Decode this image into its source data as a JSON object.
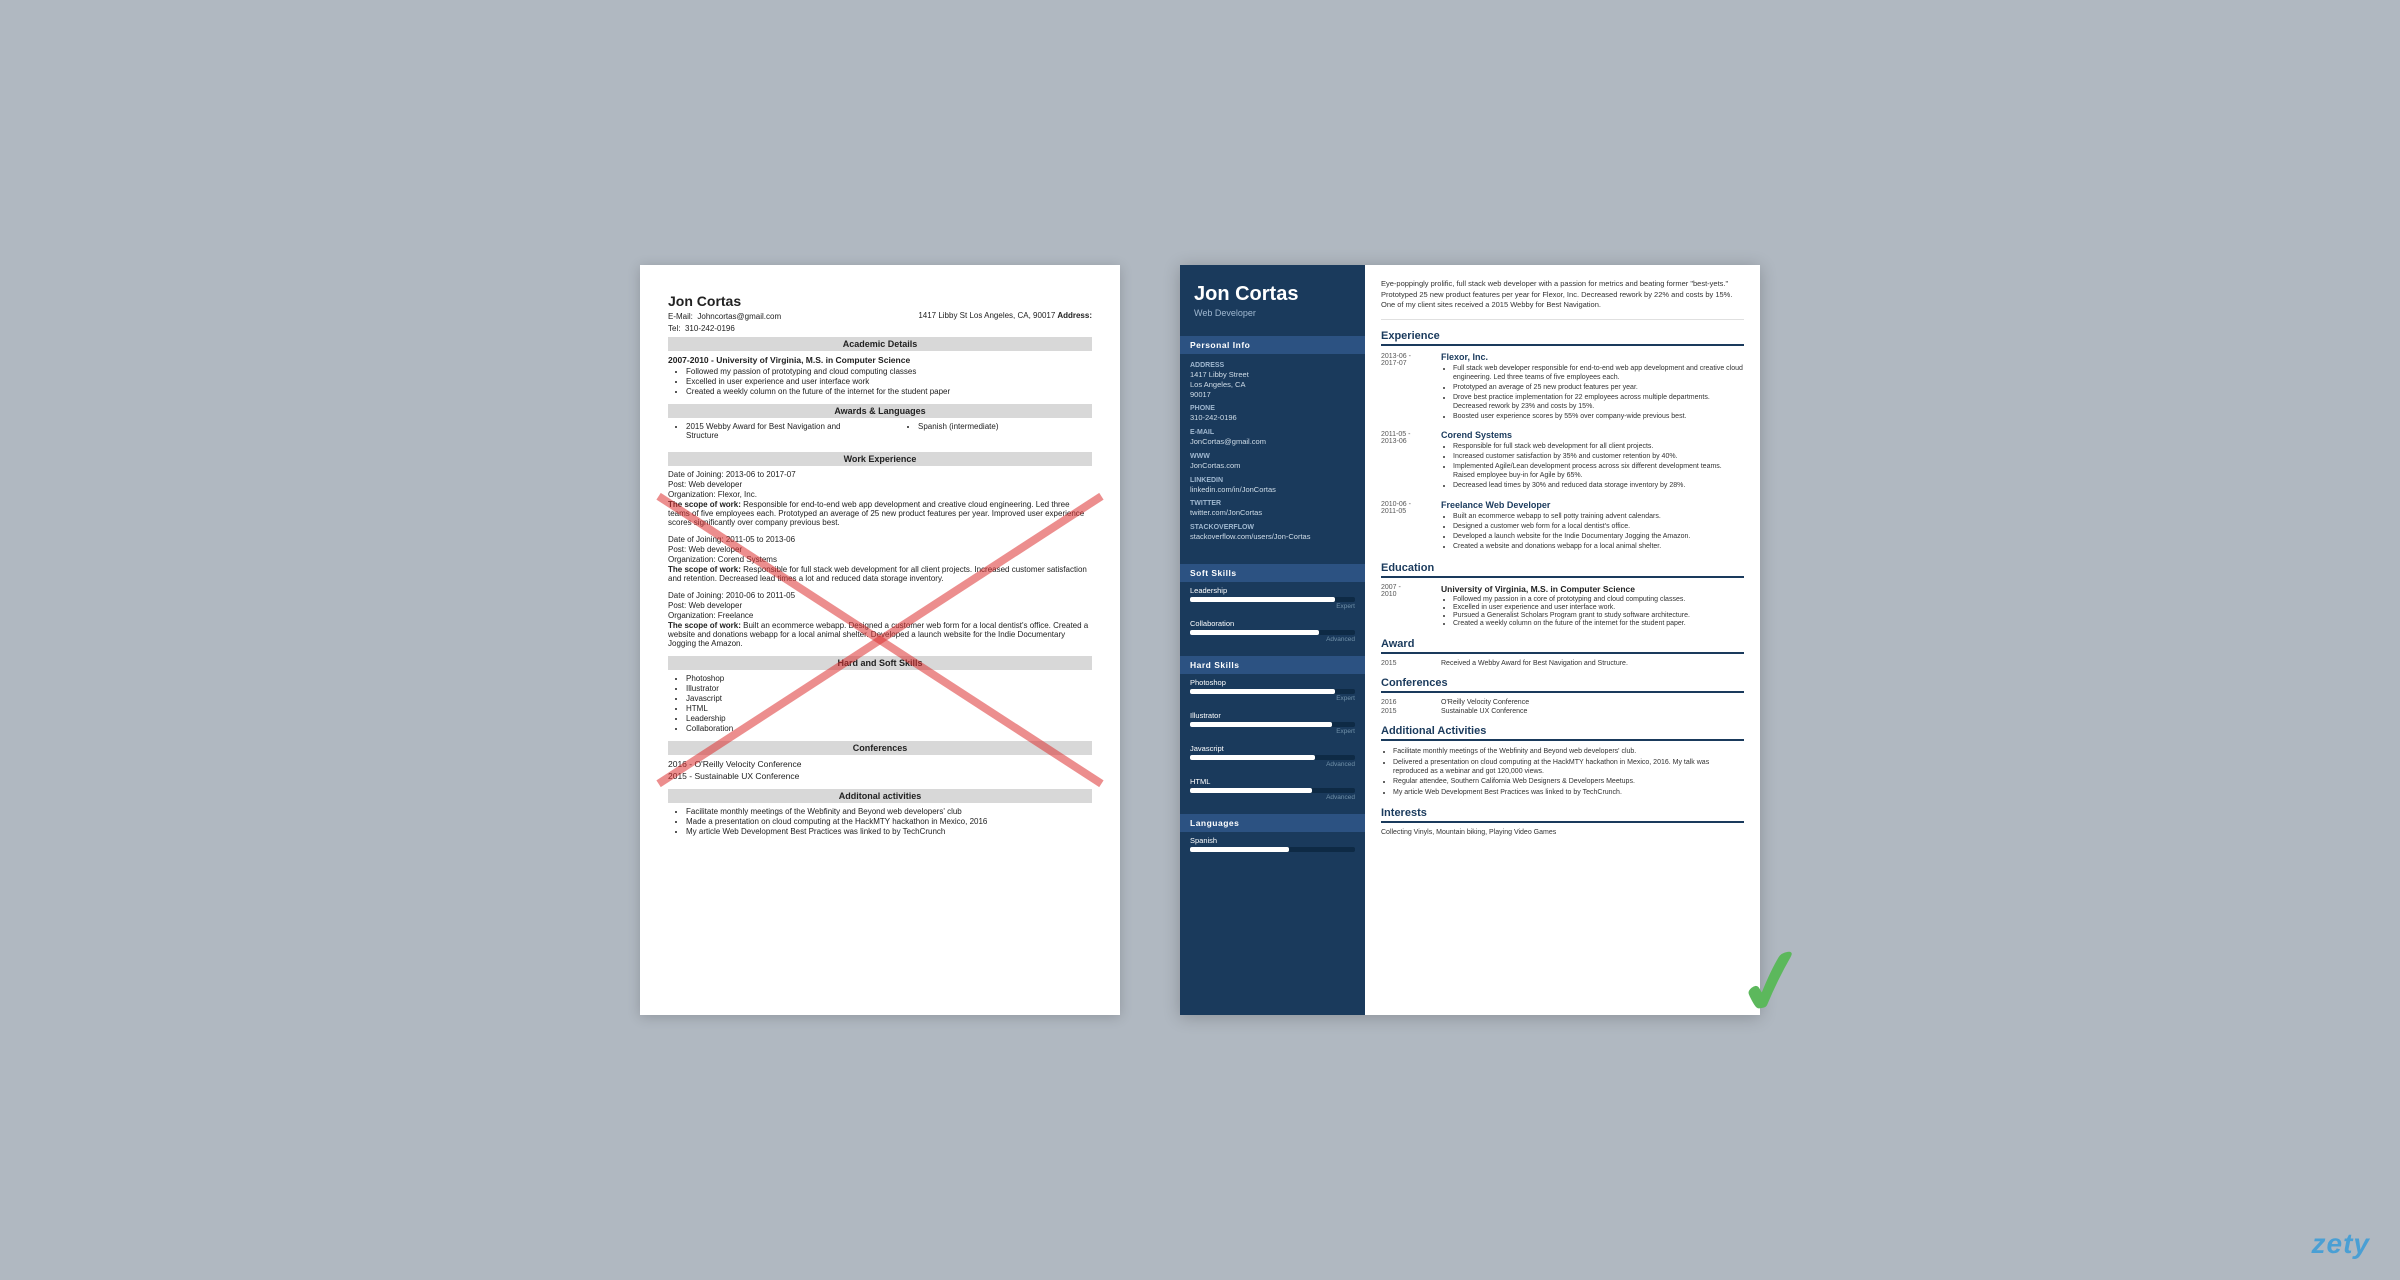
{
  "left_resume": {
    "name": "Jon Cortas",
    "email_label": "E-Mail:",
    "email": "Johncortas@gmail.com",
    "address_label": "Address:",
    "address": "1417 Libby St Los Angeles, CA, 90017",
    "tel_label": "Tel:",
    "tel": "310-242-0196",
    "academic": {
      "header": "Academic Details",
      "entry": "2007-2010 - University of Virginia, M.S. in Computer Science",
      "bullets": [
        "Followed my passion of prototyping and cloud computing classes",
        "Excelled in user experience and user interface work",
        "Created a weekly column on the future of the internet for the student paper"
      ]
    },
    "awards": {
      "header": "Awards & Languages",
      "award": "2015 Webby Award for Best Navigation and Structure",
      "language": "Spanish (intermediate)"
    },
    "work": {
      "header": "Work Experience",
      "jobs": [
        {
          "date": "Date of Joining: 2013-06 to 2017-07",
          "post": "Post: Web developer",
          "org": "Organization: Flexor, Inc.",
          "scope_label": "The scope of work:",
          "scope": "Responsible for end-to-end web app development and creative cloud engineering. Led three teams of five employees each. Prototyped an average of 25 new product features per year. Improved user experience scores significantly over company previous best."
        },
        {
          "date": "Date of Joining: 2011-05 to 2013-06",
          "post": "Post: Web developer",
          "org": "Organization: Corend Systems",
          "scope_label": "The scope of work:",
          "scope": "Responsible for full stack web development for all client projects. Increased customer satisfaction and retention. Decreased lead times a lot and reduced data storage inventory."
        },
        {
          "date": "Date of Joining: 2010-06 to 2011-05",
          "post": "Post: Web developer",
          "org": "Organization: Freelance",
          "scope_label": "The scope of work:",
          "scope": "Built an ecommerce webapp. Designed a customer web form for a local dentist's office. Created a website and donations webapp for a local animal shelter. Developed a launch website for the Indie Documentary Jogging the Amazon."
        }
      ]
    },
    "skills": {
      "header": "Hard and Soft Skills",
      "items": [
        "Photoshop",
        "Illustrator",
        "Javascript",
        "HTML",
        "Leadership",
        "Collaboration"
      ]
    },
    "conferences": {
      "header": "Conferences",
      "items": [
        "2016 - O'Reilly Velocity Conference",
        "2015 - Sustainable UX Conference"
      ]
    },
    "activities": {
      "header": "Additonal activities",
      "items": [
        "Facilitate monthly meetings of the Webfinity and Beyond web developers' club",
        "Made a presentation on cloud computing at the HackMTY hackathon in Mexico, 2016",
        "My article Web Development Best Practices was linked to by TechCrunch"
      ]
    }
  },
  "right_resume": {
    "name": "Jon Cortas",
    "title": "Web Developer",
    "summary": "Eye-poppingly prolific, full stack web developer with a passion for metrics and beating former \"best-yets.\" Prototyped 25 new product features per year for Flexor, Inc. Decreased rework by 22% and costs by 15%. One of my client sites received a 2015 Webby for Best Navigation.",
    "sidebar": {
      "personal_info_label": "Personal Info",
      "address_label": "Address",
      "address": "1417 Libby Street\nLos Angeles, CA\n90017",
      "phone_label": "Phone",
      "phone": "310-242-0196",
      "email_label": "E-mail",
      "email": "JonCortas@gmail.com",
      "www_label": "WWW",
      "www": "JonCortas.com",
      "linkedin_label": "LinkedIn",
      "linkedin": "linkedin.com/in/JonCortas",
      "twitter_label": "Twitter",
      "twitter": "twitter.com/JonCortas",
      "stackoverflow_label": "StackOverflow",
      "stackoverflow": "stackoverflow.com/users/Jon-Cortas",
      "soft_skills_label": "Soft Skills",
      "soft_skills": [
        {
          "name": "Leadership",
          "level": "Expert",
          "pct": 88
        },
        {
          "name": "Collaboration",
          "level": "Advanced",
          "pct": 78
        }
      ],
      "hard_skills_label": "Hard Skills",
      "hard_skills": [
        {
          "name": "Photoshop",
          "level": "Expert",
          "pct": 88
        },
        {
          "name": "Illustrator",
          "level": "Expert",
          "pct": 86
        },
        {
          "name": "Javascript",
          "level": "Advanced",
          "pct": 76
        },
        {
          "name": "HTML",
          "level": "Advanced",
          "pct": 74
        }
      ],
      "languages_label": "Languages",
      "languages": [
        {
          "name": "Spanish",
          "level": "",
          "pct": 60
        }
      ]
    },
    "experience": {
      "label": "Experience",
      "jobs": [
        {
          "date": "2013-06 -\n2017-07",
          "company": "Flexor, Inc.",
          "bullets": [
            "Full stack web developer responsible for end-to-end web app development and creative cloud engineering. Led three teams of five employees each.",
            "Prototyped an average of 25 new product features per year.",
            "Drove best practice implementation for 22 employees across multiple departments. Decreased rework by 23% and costs by 15%.",
            "Boosted user experience scores by 55% over company-wide previous best."
          ]
        },
        {
          "date": "2011-05 -\n2013-06",
          "company": "Corend Systems",
          "bullets": [
            "Responsible for full stack web development for all client projects.",
            "Increased customer satisfaction by 35% and customer retention by 40%.",
            "Implemented Agile/Lean development process across six different development teams. Raised employee buy-in for Agile by 65%.",
            "Decreased lead times by 30% and reduced data storage inventory by 28%."
          ]
        },
        {
          "date": "2010-06 -\n2011-05",
          "company": "Freelance Web Developer",
          "bullets": [
            "Built an ecommerce webapp to sell potty training advent calendars.",
            "Designed a customer web form for a local dentist's office.",
            "Developed a launch website for the Indie Documentary Jogging the Amazon.",
            "Created a website and donations webapp for a local animal shelter."
          ]
        }
      ]
    },
    "education": {
      "label": "Education",
      "entries": [
        {
          "date": "2007 -\n2010",
          "degree": "University of Virginia, M.S. in Computer Science",
          "bullets": [
            "Followed my passion in a core of prototyping and cloud computing classes.",
            "Excelled in user experience and user interface work.",
            "Pursued a Generalist Scholars Program grant to study software architecture.",
            "Created a weekly column on the future of the internet for the student paper."
          ]
        }
      ]
    },
    "award": {
      "label": "Award",
      "entries": [
        {
          "year": "2015",
          "text": "Received a Webby Award for Best Navigation and Structure."
        }
      ]
    },
    "conferences": {
      "label": "Conferences",
      "entries": [
        {
          "year": "2016",
          "name": "O'Reilly Velocity Conference"
        },
        {
          "year": "2015",
          "name": "Sustainable UX Conference"
        }
      ]
    },
    "activities": {
      "label": "Additional Activities",
      "items": [
        "Facilitate monthly meetings of the Webfinity and Beyond web developers' club.",
        "Delivered a presentation on cloud computing at the HackMTY hackathon in Mexico, 2016. My talk was reproduced as a webinar and got 120,000 views.",
        "Regular attendee, Southern California Web Designers & Developers Meetups.",
        "My article Web Development Best Practices was linked to by TechCrunch."
      ]
    },
    "interests": {
      "label": "Interests",
      "text": "Collecting Vinyls, Mountain biking, Playing Video Games"
    }
  },
  "watermark": "zety"
}
